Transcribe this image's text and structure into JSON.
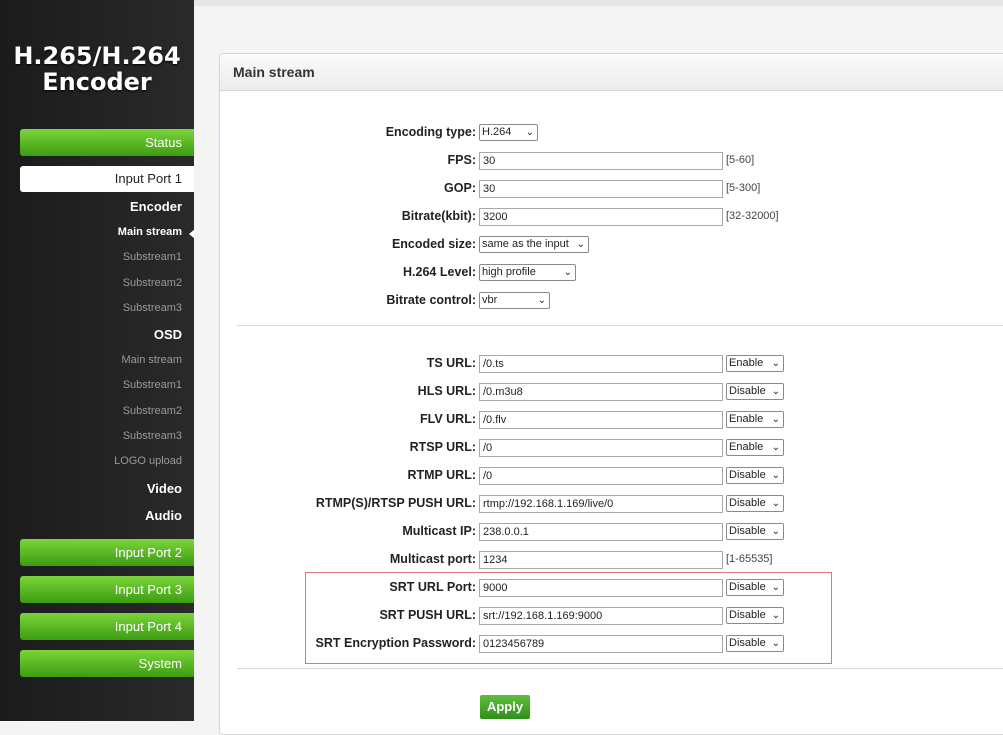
{
  "sidebar": {
    "logo_line1": "H.265/H.264",
    "logo_line2": "Encoder",
    "status": "Status",
    "input_port_1": "Input Port 1",
    "encoder": "Encoder",
    "encoder_main": "Main stream",
    "encoder_sub1": "Substream1",
    "encoder_sub2": "Substream2",
    "encoder_sub3": "Substream3",
    "osd": "OSD",
    "osd_main": "Main stream",
    "osd_sub1": "Substream1",
    "osd_sub2": "Substream2",
    "osd_sub3": "Substream3",
    "logo_upload": "LOGO upload",
    "video": "Video",
    "audio": "Audio",
    "input_port_2": "Input Port 2",
    "input_port_3": "Input Port 3",
    "input_port_4": "Input Port 4",
    "system": "System"
  },
  "panel": {
    "title": "Main stream"
  },
  "fields": {
    "encoding_type": {
      "label": "Encoding type:",
      "value": "H.264"
    },
    "fps": {
      "label": "FPS:",
      "value": "30",
      "hint": "[5-60]"
    },
    "gop": {
      "label": "GOP:",
      "value": "30",
      "hint": "[5-300]"
    },
    "bitrate": {
      "label": "Bitrate(kbit):",
      "value": "3200",
      "hint": "[32-32000]"
    },
    "encoded_size": {
      "label": "Encoded size:",
      "value": "same as the input"
    },
    "h264_level": {
      "label": "H.264 Level:",
      "value": "high profile"
    },
    "bitrate_control": {
      "label": "Bitrate control:",
      "value": "vbr"
    },
    "ts_url": {
      "label": "TS URL:",
      "value": "/0.ts",
      "state": "Enable"
    },
    "hls_url": {
      "label": "HLS URL:",
      "value": "/0.m3u8",
      "state": "Disable"
    },
    "flv_url": {
      "label": "FLV URL:",
      "value": "/0.flv",
      "state": "Enable"
    },
    "rtsp_url": {
      "label": "RTSP URL:",
      "value": "/0",
      "state": "Enable"
    },
    "rtmp_url": {
      "label": "RTMP URL:",
      "value": "/0",
      "state": "Disable"
    },
    "push_url": {
      "label": "RTMP(S)/RTSP PUSH URL:",
      "value": "rtmp://192.168.1.169/live/0",
      "state": "Disable"
    },
    "multicast_ip": {
      "label": "Multicast IP:",
      "value": "238.0.0.1",
      "state": "Disable"
    },
    "multicast_port": {
      "label": "Multicast port:",
      "value": "1234",
      "hint": "[1-65535]"
    },
    "srt_port": {
      "label": "SRT URL Port:",
      "value": "9000",
      "state": "Disable"
    },
    "srt_push": {
      "label": "SRT PUSH URL:",
      "value": "srt://192.168.1.169:9000",
      "state": "Disable"
    },
    "srt_password": {
      "label": "SRT Encryption Password:",
      "value": "0123456789",
      "state": "Disable"
    }
  },
  "apply_label": "Apply",
  "colors": {
    "accent_green": "#3c9d12",
    "highlight_red": "#d87a76"
  }
}
